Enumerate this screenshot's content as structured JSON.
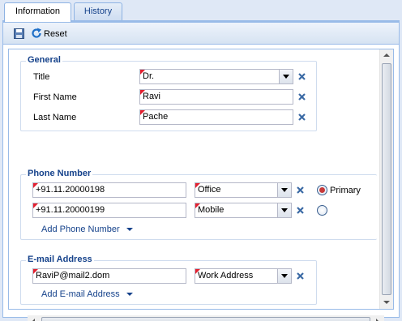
{
  "tabs": [
    {
      "label": "Information",
      "active": true
    },
    {
      "label": "History",
      "active": false
    }
  ],
  "toolbar": {
    "reset_label": "Reset"
  },
  "general": {
    "legend": "General",
    "title_label": "Title",
    "title_value": "Dr.",
    "first_name_label": "First Name",
    "first_name_value": "Ravi",
    "last_name_label": "Last Name",
    "last_name_value": "Pache"
  },
  "phone": {
    "legend": "Phone Number",
    "rows": [
      {
        "number": "+91.11.20000198",
        "type": "Office",
        "primary": true
      },
      {
        "number": "+91.11.20000199",
        "type": "Mobile",
        "primary": false
      }
    ],
    "primary_label": "Primary",
    "add_label": "Add Phone Number"
  },
  "email": {
    "legend": "E-mail Address",
    "value": "RaviP@mail2.dom",
    "type": "Work Address",
    "add_label": "Add E-mail Address"
  },
  "colors": {
    "accent": "#15428b",
    "required_flag": "#e4202f",
    "remove_icon": "#3b6aa5"
  }
}
